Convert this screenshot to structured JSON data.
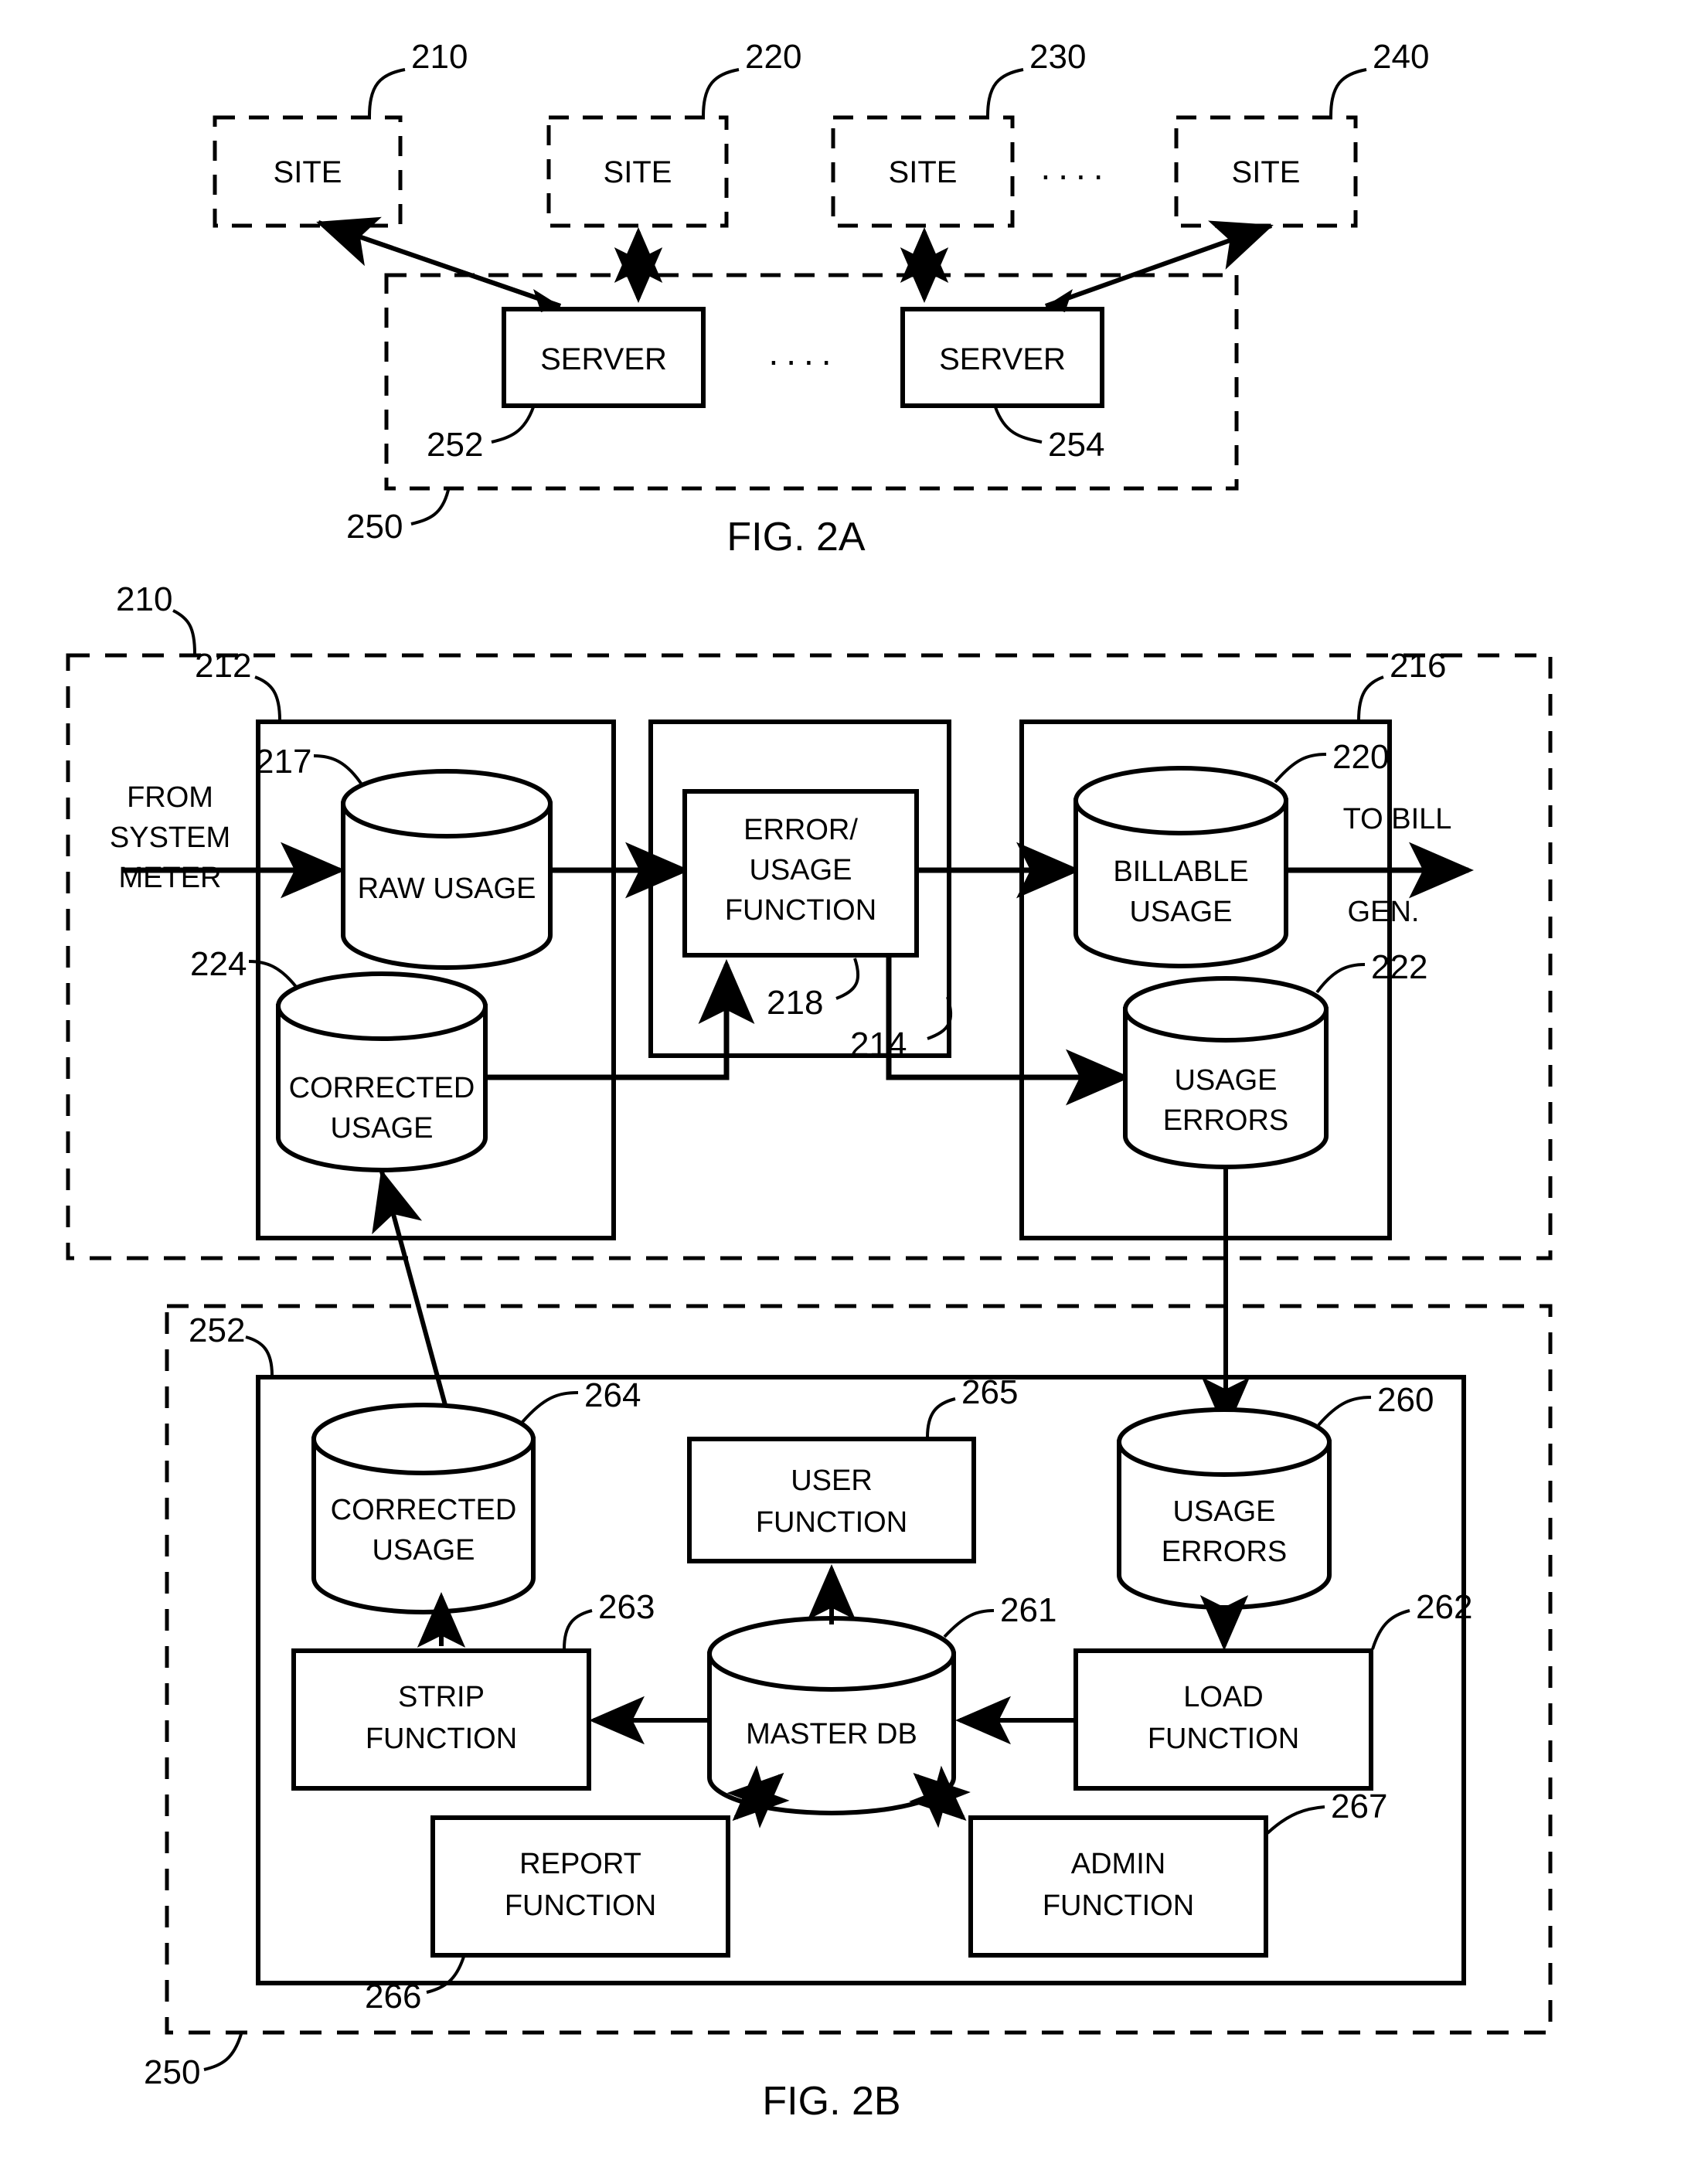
{
  "figures": [
    {
      "id": "fig-2a",
      "caption": "FIG. 2A",
      "sites": [
        {
          "label": "SITE",
          "ref": "210"
        },
        {
          "label": "SITE",
          "ref": "220"
        },
        {
          "label": "SITE",
          "ref": "230"
        },
        {
          "label": "SITE",
          "ref": "240"
        }
      ],
      "site_ellipsis": "....",
      "servers": [
        {
          "label": "SERVER",
          "ref": "252"
        },
        {
          "label": "SERVER",
          "ref": "254"
        }
      ],
      "server_ellipsis": "....",
      "network_ref": "250"
    },
    {
      "id": "fig-2b",
      "caption": "FIG. 2B",
      "site_block": {
        "ref": "210",
        "input_label_line1": "FROM",
        "input_label_line2": "SYSTEM",
        "input_label_line3": "METER",
        "output_label_line1": "TO BILL",
        "output_label_line2": "GEN.",
        "inner_blocks": [
          {
            "ref": "212"
          },
          {
            "ref": "214"
          },
          {
            "ref": "216"
          }
        ],
        "nodes": [
          {
            "label_line1": "RAW USAGE",
            "label_line2": "",
            "ref": "217",
            "shape": "cylinder"
          },
          {
            "label_line1": "CORRECTED",
            "label_line2": "USAGE",
            "ref": "224",
            "shape": "cylinder"
          },
          {
            "label_line1": "ERROR/",
            "label_line2": "USAGE",
            "label_line3": "FUNCTION",
            "ref": "218",
            "shape": "box"
          },
          {
            "label_line1": "BILLABLE",
            "label_line2": "USAGE",
            "ref": "220",
            "shape": "cylinder"
          },
          {
            "label_line1": "USAGE",
            "label_line2": "ERRORS",
            "ref": "222",
            "shape": "cylinder"
          }
        ]
      },
      "server_block": {
        "ref": "252",
        "network_ref": "250",
        "nodes": [
          {
            "label_line1": "CORRECTED",
            "label_line2": "USAGE",
            "ref": "264",
            "shape": "cylinder"
          },
          {
            "label_line1": "USER",
            "label_line2": "FUNCTION",
            "ref": "265",
            "shape": "box"
          },
          {
            "label_line1": "USAGE",
            "label_line2": "ERRORS",
            "ref": "260",
            "shape": "cylinder"
          },
          {
            "label_line1": "MASTER DB",
            "label_line2": "",
            "ref": "261",
            "shape": "cylinder"
          },
          {
            "label_line1": "STRIP",
            "label_line2": "FUNCTION",
            "ref": "263",
            "shape": "box"
          },
          {
            "label_line1": "LOAD",
            "label_line2": "FUNCTION",
            "ref": "262",
            "shape": "box"
          },
          {
            "label_line1": "REPORT",
            "label_line2": "FUNCTION",
            "ref": "266",
            "shape": "box"
          },
          {
            "label_line1": "ADMIN",
            "label_line2": "FUNCTION",
            "ref": "267",
            "shape": "box"
          }
        ]
      }
    }
  ],
  "colors": {
    "ink": "#000000",
    "paper": "#ffffff"
  }
}
